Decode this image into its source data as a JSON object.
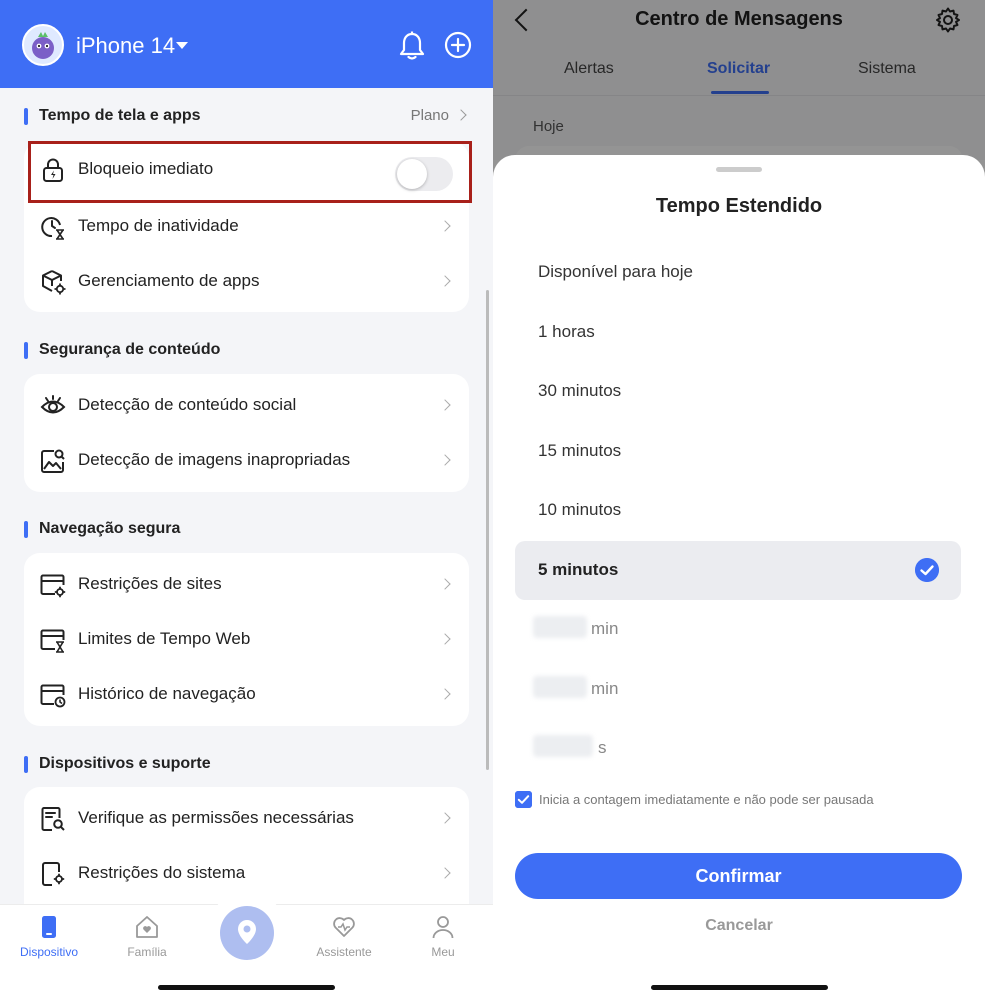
{
  "left": {
    "device_name": "iPhone 14",
    "sections": [
      {
        "title": "Tempo de tela e apps",
        "link": "Plano"
      },
      {
        "title": "Segurança de conteúdo"
      },
      {
        "title": "Navegação segura"
      },
      {
        "title": "Dispositivos e suporte"
      }
    ],
    "rows": {
      "instant_lock": "Bloqueio imediato",
      "inactivity": "Tempo de inatividade",
      "app_management": "Gerenciamento de apps",
      "social_detection": "Detecção de conteúdo social",
      "image_detection": "Detecção de imagens inapropriadas",
      "site_restrictions": "Restrições de sites",
      "web_time_limits": "Limites de Tempo Web",
      "browsing_history": "Histórico de navegação",
      "check_permissions": "Verifique as permissões necessárias",
      "system_restrictions": "Restrições do sistema"
    },
    "tabs": {
      "device": "Dispositivo",
      "family": "Família",
      "assistant": "Assistente",
      "me": "Meu"
    }
  },
  "right": {
    "title": "Centro de Mensagens",
    "tabs": [
      "Alertas",
      "Solicitar",
      "Sistema"
    ],
    "active_tab": "Solicitar",
    "date_label": "Hoje",
    "sheet": {
      "title": "Tempo Estendido",
      "options": [
        {
          "label": "Disponível para hoje",
          "selected": false
        },
        {
          "label": "1 horas",
          "selected": false
        },
        {
          "label": "30 minutos",
          "selected": false
        },
        {
          "label": "15 minutos",
          "selected": false
        },
        {
          "label": "10 minutos",
          "selected": false
        },
        {
          "label": "5 minutos",
          "selected": true
        },
        {
          "label": "min",
          "selected": false,
          "blurred": true
        },
        {
          "label": "min",
          "selected": false,
          "blurred": true
        },
        {
          "label": "s",
          "selected": false,
          "blurred": true
        }
      ],
      "agreement_text": "Inicia a contagem imediatamente e não pode ser pausada",
      "agreement_checked": true,
      "confirm_label": "Confirmar",
      "cancel_label": "Cancelar"
    }
  },
  "colors": {
    "accent": "#3e6ef5",
    "highlight_border": "#a8201a"
  }
}
